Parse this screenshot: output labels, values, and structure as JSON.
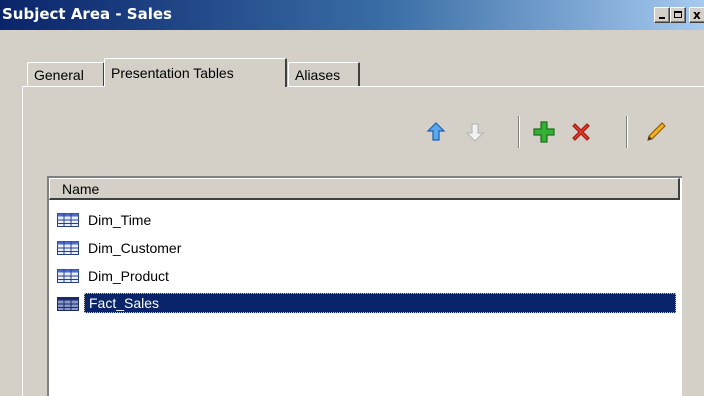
{
  "window": {
    "title": "Subject Area - Sales",
    "controls": {
      "minimize": "_",
      "maximize": "□",
      "close": "x"
    }
  },
  "tabs": [
    {
      "label": "General",
      "active": false
    },
    {
      "label": "Presentation Tables",
      "active": true
    },
    {
      "label": "Aliases",
      "active": false
    }
  ],
  "toolbar": {
    "buttons": [
      {
        "name": "move-up",
        "icon": "arrow-up-icon",
        "color": "#3a8ee6"
      },
      {
        "name": "move-down",
        "icon": "arrow-down-icon",
        "color": "#c8c8c8"
      },
      {
        "name": "add",
        "icon": "plus-icon",
        "color": "#2ca02c"
      },
      {
        "name": "delete",
        "icon": "x-icon",
        "color": "#e02020"
      },
      {
        "name": "edit",
        "icon": "pencil-icon",
        "color": "#e0a020"
      }
    ]
  },
  "list": {
    "column_header": "Name",
    "items": [
      {
        "label": "Dim_Time",
        "icon": "table-icon",
        "selected": false
      },
      {
        "label": "Dim_Customer",
        "icon": "table-icon",
        "selected": false
      },
      {
        "label": "Dim_Product",
        "icon": "table-icon",
        "selected": false
      },
      {
        "label": "Fact_Sales",
        "icon": "table-icon",
        "selected": true
      }
    ]
  },
  "colors": {
    "title_bar_start": "#0a246a",
    "title_bar_end": "#a6caf0",
    "dialog_bg": "#d4d0c8",
    "selection_bg": "#0a246a"
  }
}
